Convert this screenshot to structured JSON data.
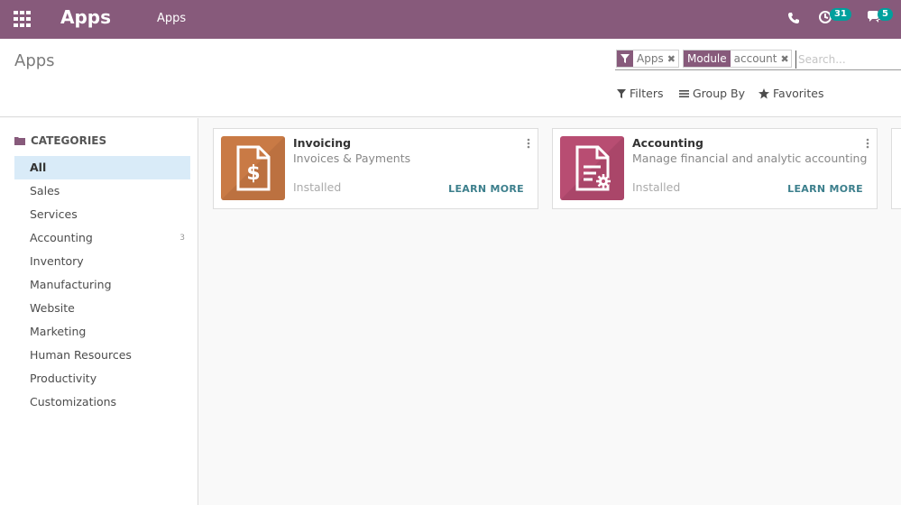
{
  "navbar": {
    "brand": "Apps",
    "menu_item": "Apps",
    "activity_count": "31",
    "message_count": "5",
    "color": "#875a7b"
  },
  "control_panel": {
    "breadcrumb": "Apps",
    "facets": [
      {
        "icon": "filter-icon",
        "value": "Apps"
      },
      {
        "label": "Module",
        "value": "account"
      }
    ],
    "search_placeholder": "Search...",
    "filters_label": "Filters",
    "groupby_label": "Group By",
    "favorites_label": "Favorites"
  },
  "sidebar": {
    "header": "CATEGORIES",
    "items": [
      {
        "label": "All",
        "active": true
      },
      {
        "label": "Sales"
      },
      {
        "label": "Services"
      },
      {
        "label": "Accounting",
        "count": "3"
      },
      {
        "label": "Inventory"
      },
      {
        "label": "Manufacturing"
      },
      {
        "label": "Website"
      },
      {
        "label": "Marketing"
      },
      {
        "label": "Human Resources"
      },
      {
        "label": "Productivity"
      },
      {
        "label": "Customizations"
      }
    ]
  },
  "apps": [
    {
      "name": "Invoicing",
      "summary": "Invoices & Payments",
      "status": "Installed",
      "action": "LEARN MORE",
      "icon": "invoice-dollar-icon",
      "color": "#c97a45"
    },
    {
      "name": "Accounting",
      "summary": "Manage financial and analytic accounting",
      "status": "Installed",
      "action": "LEARN MORE",
      "icon": "document-gear-icon",
      "color": "#b84d72"
    }
  ]
}
